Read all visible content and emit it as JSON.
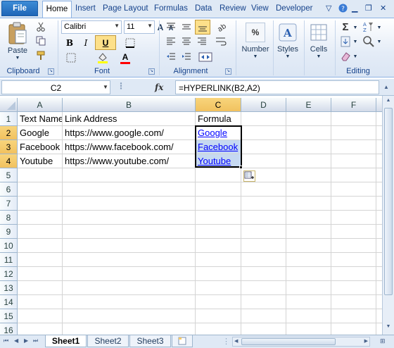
{
  "ribbon": {
    "tabs": [
      "File",
      "Home",
      "Insert",
      "Page Layout",
      "Formulas",
      "Data",
      "Review",
      "View",
      "Developer"
    ],
    "clipboard": {
      "paste_label": "Paste",
      "group_label": "Clipboard"
    },
    "font": {
      "name": "Calibri",
      "size": "11",
      "bold": "B",
      "italic": "I",
      "underline": "U",
      "grow": "A",
      "shrink": "A",
      "color_glyph": "A",
      "group_label": "Font"
    },
    "alignment": {
      "group_label": "Alignment"
    },
    "number": {
      "label": "Number",
      "symbol": "%"
    },
    "styles": {
      "label": "Styles"
    },
    "cells": {
      "label": "Cells"
    },
    "editing": {
      "group_label": "Editing",
      "sum_glyph": "Σ"
    }
  },
  "formula_bar": {
    "name_box": "C2",
    "fx": "fx",
    "formula": "=HYPERLINK(B2,A2)"
  },
  "grid": {
    "columns": [
      "A",
      "B",
      "C",
      "D",
      "E",
      "F"
    ],
    "rows": [
      "1",
      "2",
      "3",
      "4",
      "5",
      "6",
      "7",
      "8",
      "9",
      "10",
      "11",
      "12",
      "13",
      "14",
      "15",
      "16"
    ],
    "data": [
      [
        "Text Name",
        "Link Address",
        "Formula"
      ],
      [
        "Google",
        "https://www.google.com/",
        "Google"
      ],
      [
        "Facebook",
        "https://www.facebook.com/",
        "Facebook"
      ],
      [
        "Youtube",
        "https://www.youtube.com/",
        "Youtube"
      ]
    ],
    "selected_column": "C",
    "selected_rows": [
      "2",
      "3",
      "4"
    ]
  },
  "sheets": [
    "Sheet1",
    "Sheet2",
    "Sheet3"
  ],
  "active_sheet": "Sheet1",
  "colors": {
    "ribbon_bg": "#dfe9f5",
    "file_tab": "#2b76c8",
    "selection_header": "#f5c96a",
    "link": "#0000ff",
    "highlight": "#c6d9f1"
  }
}
